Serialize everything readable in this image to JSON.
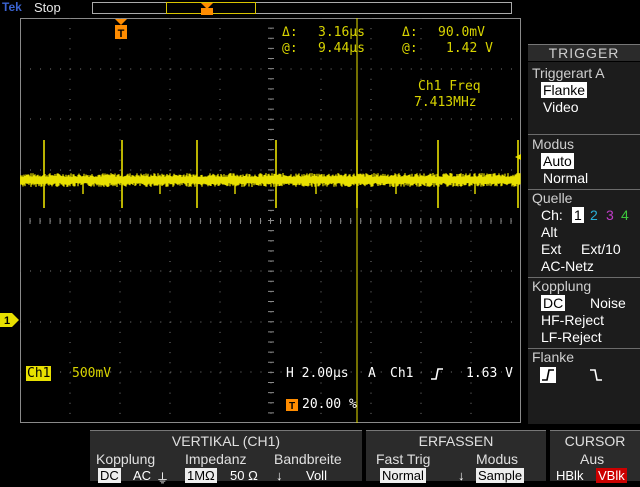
{
  "header": {
    "brand": "Tek",
    "status": "Stop"
  },
  "readout": {
    "delta_t_sym": "Δ:",
    "delta_t": "3.16μs",
    "delta_v_sym": "Δ:",
    "delta_v": "90.0mV",
    "at_t_sym": "@:",
    "at_t": "9.44μs",
    "at_v_sym": "@:",
    "at_v": "1.42 V",
    "freq_label": "Ch1 Freq",
    "freq_value": "7.413MHz",
    "ch1_label": "Ch1",
    "ch1_scale": "500mV",
    "timebase": "H 2.00μs",
    "trig_mode": "A",
    "trig_src": "Ch1",
    "trig_level": "1.63 V",
    "trig_pos": "20.00 %",
    "trig_marker": "T",
    "ch_marker": "1"
  },
  "side_menu": {
    "title": "TRIGGER",
    "triggerart_label": "Triggerart A",
    "triggerart_flanke": "Flanke",
    "triggerart_video": "Video",
    "modus_label": "Modus",
    "modus_auto": "Auto",
    "modus_normal": "Normal",
    "quelle_label": "Quelle",
    "quelle_ch": "Ch:",
    "quelle_1": "1",
    "quelle_2": "2",
    "quelle_3": "3",
    "quelle_4": "4",
    "quelle_alt": "Alt",
    "quelle_ext": "Ext",
    "quelle_ext10": "Ext/10",
    "quelle_acnetz": "AC-Netz",
    "kopplung_label": "Kopplung",
    "kopplung_dc": "DC",
    "kopplung_noise": "Noise",
    "kopplung_hf": "HF-Reject",
    "kopplung_lf": "LF-Reject",
    "flanke_label": "Flanke",
    "flanke_rise": "⌐",
    "flanke_fall": "⌐"
  },
  "bottom_menu": {
    "vertikal_title": "VERTIKAL (CH1)",
    "kopplung_label": "Kopplung",
    "kopplung_dc": "DC",
    "kopplung_ac": "AC",
    "kopplung_gnd": "⏚",
    "impedanz_label": "Impedanz",
    "impedanz_1m": "1MΩ",
    "impedanz_50": "50 Ω",
    "bandbreite_label": "Bandbreite",
    "bandbreite_value": "Voll",
    "erfassen_title": "ERFASSEN",
    "fast_trig_label": "Fast Trig",
    "fast_trig_value": "Normal",
    "modus_label": "Modus",
    "modus_value": "Sample",
    "cursor_title": "CURSOR",
    "cursor_label": "Aus",
    "cursor_hblk": "HBlk",
    "cursor_vblk": "VBlk"
  },
  "colors": {
    "ch1": "#e8e000",
    "ch2": "#2ab0d8",
    "ch3": "#c03cc8",
    "ch4": "#3cc83c",
    "trigger_marker": "#ff8c00"
  }
}
